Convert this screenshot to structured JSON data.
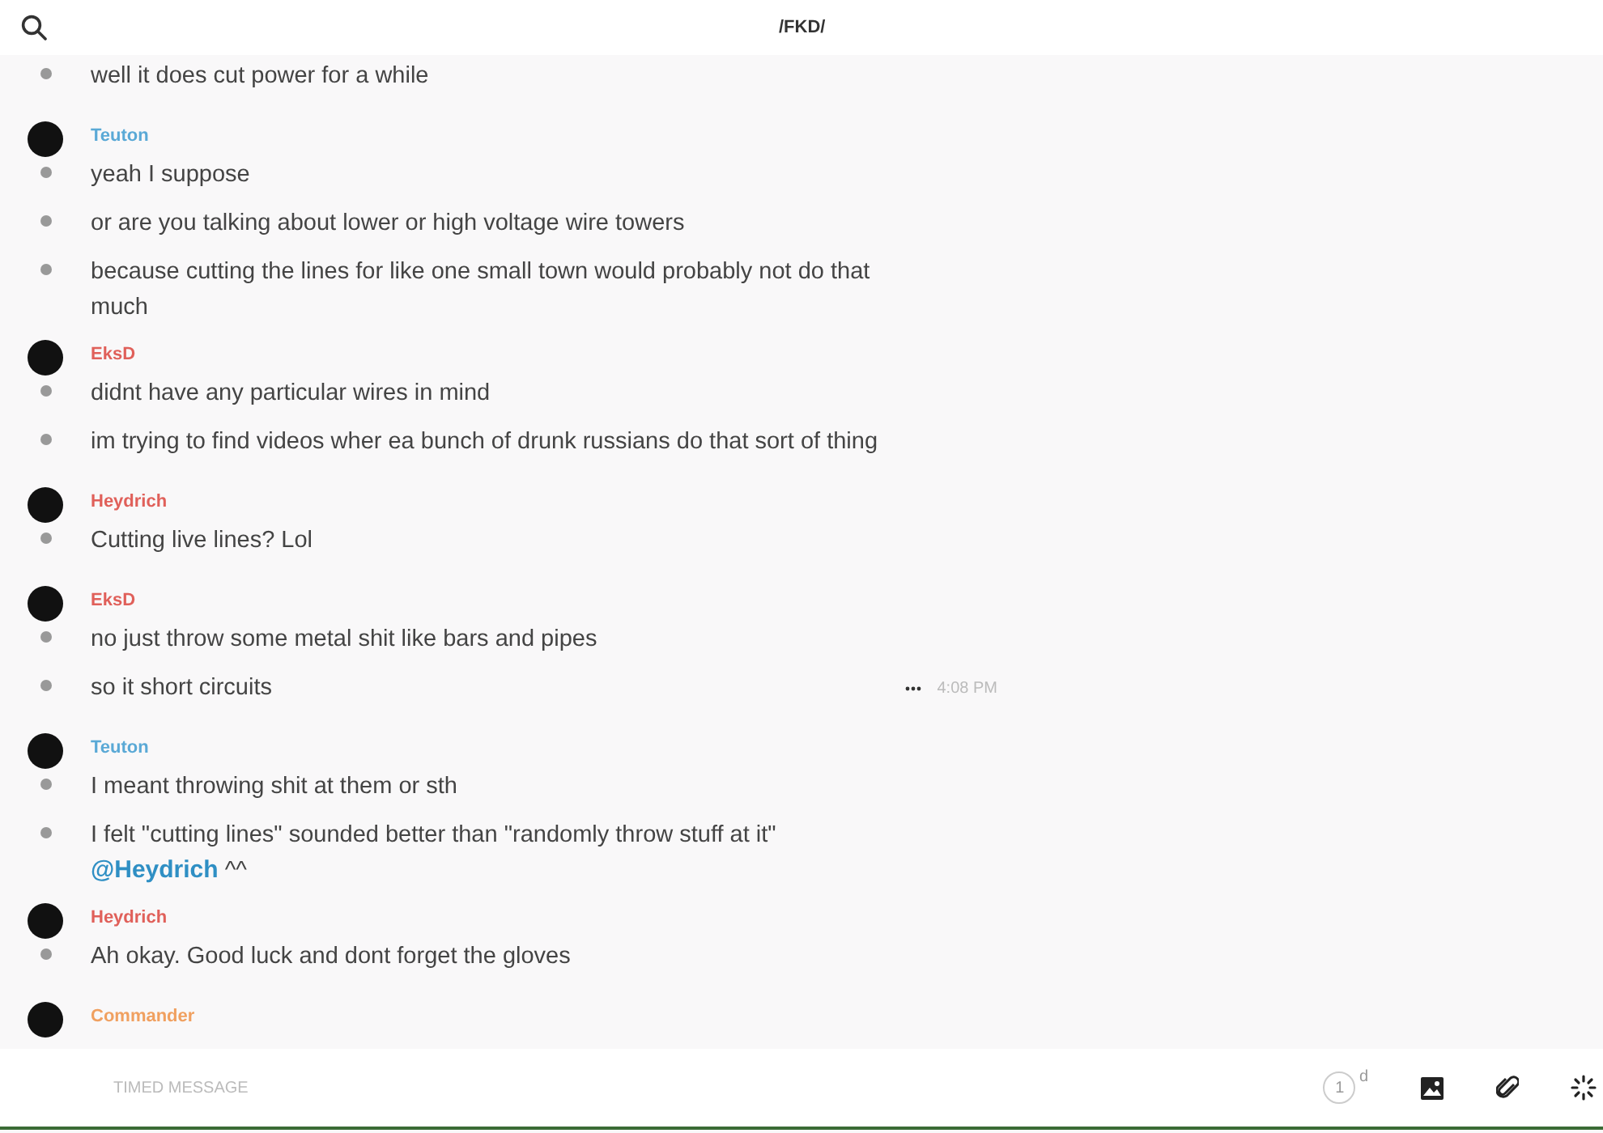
{
  "header": {
    "title": "/FKD/"
  },
  "groups": [
    {
      "messages": [
        {
          "text": "well it does cut power for a while"
        }
      ]
    },
    {
      "author": "Teuton",
      "color": "#5aa9d6",
      "messages": [
        {
          "text": "yeah I suppose"
        },
        {
          "text": "or are you talking about lower or high voltage wire towers"
        },
        {
          "text": "because cutting the lines for like one small town would probably not do that much"
        }
      ]
    },
    {
      "author": "EksD",
      "color": "#e0605a",
      "messages": [
        {
          "text": "didnt have any particular wires in mind"
        },
        {
          "text": "im trying to find videos wher ea bunch of drunk russians do that sort of thing"
        }
      ]
    },
    {
      "author": "Heydrich",
      "color": "#e0605a",
      "messages": [
        {
          "text": "Cutting live lines? Lol"
        }
      ]
    },
    {
      "author": "EksD",
      "color": "#e0605a",
      "messages": [
        {
          "text": "no just throw some metal shit like bars and pipes"
        },
        {
          "text": "so it short circuits",
          "time": "4:08 PM"
        }
      ]
    },
    {
      "author": "Teuton",
      "color": "#5aa9d6",
      "messages": [
        {
          "text": "I meant throwing shit at them or sth"
        },
        {
          "text": "I felt \"cutting lines\" sounded better than \"randomly throw stuff at it\"",
          "mention": "@Heydrich",
          "after": "^^"
        }
      ]
    },
    {
      "author": "Heydrich",
      "color": "#e0605a",
      "messages": [
        {
          "text": "Ah okay. Good luck and dont forget the gloves"
        }
      ]
    },
    {
      "author": "Commander",
      "color": "#f0a060"
    }
  ],
  "composer": {
    "placeholder": "TIMED MESSAGE",
    "timer_count": "1",
    "timer_unit": "d"
  }
}
